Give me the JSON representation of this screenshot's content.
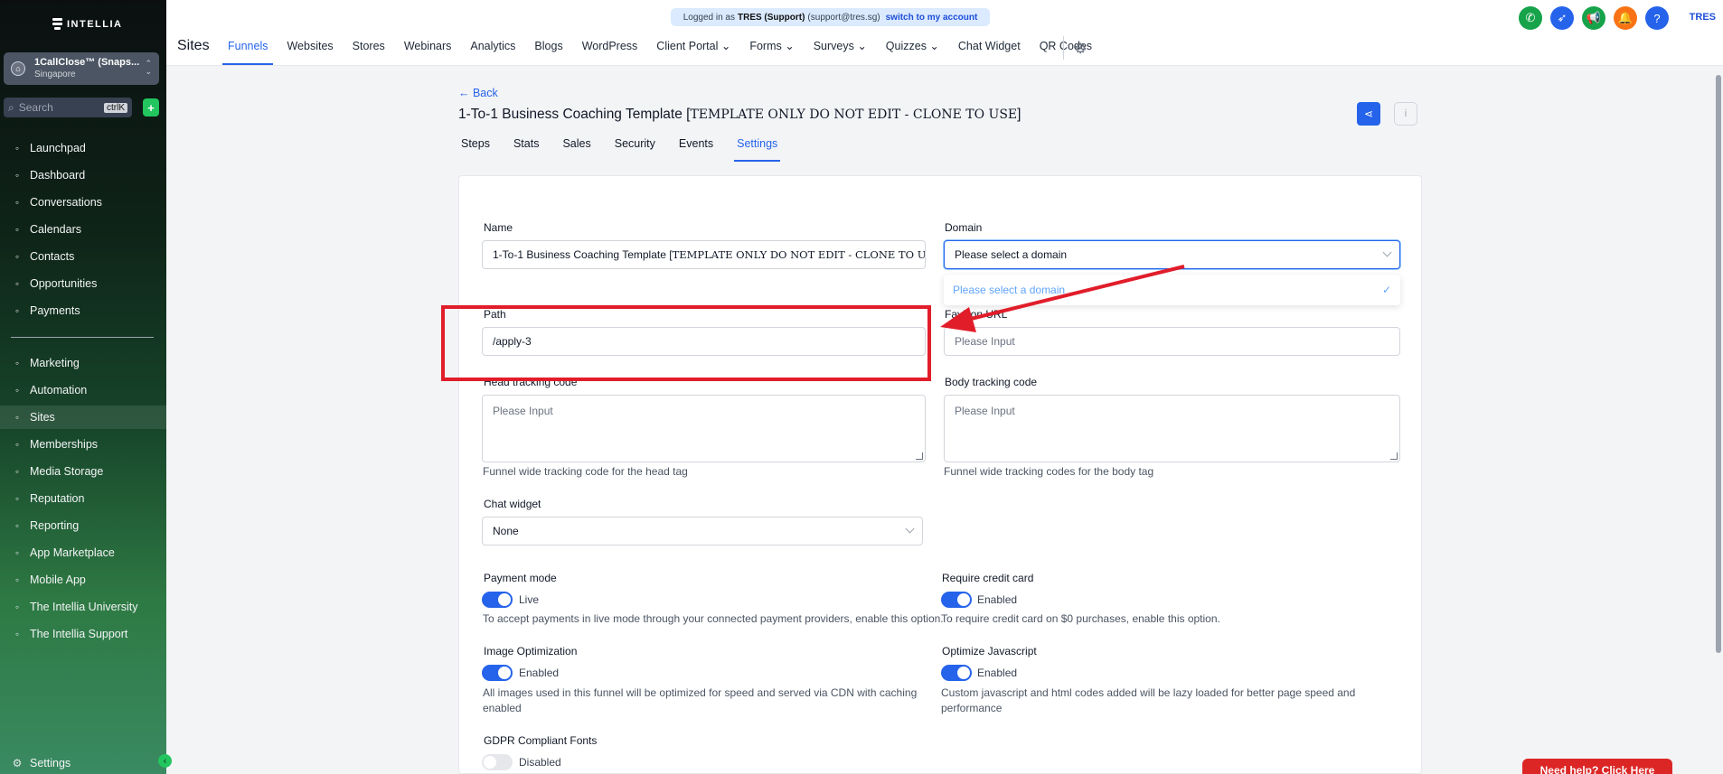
{
  "app": {
    "brand": "INTELLIA"
  },
  "account": {
    "name": "1CallClose™ (Snaps...",
    "location": "Singapore"
  },
  "search": {
    "placeholder": "Search",
    "shortcut": "ctrlK"
  },
  "sidebar": {
    "group1": [
      {
        "label": "Launchpad",
        "icon": "rocket-icon"
      },
      {
        "label": "Dashboard",
        "icon": "grid-icon"
      },
      {
        "label": "Conversations",
        "icon": "chat-icon"
      },
      {
        "label": "Calendars",
        "icon": "calendar-icon"
      },
      {
        "label": "Contacts",
        "icon": "contacts-icon"
      },
      {
        "label": "Opportunities",
        "icon": "opportunities-icon"
      },
      {
        "label": "Payments",
        "icon": "payments-icon"
      }
    ],
    "group2": [
      {
        "label": "Marketing",
        "icon": "send-icon"
      },
      {
        "label": "Automation",
        "icon": "automation-icon"
      },
      {
        "label": "Sites",
        "icon": "sites-icon"
      },
      {
        "label": "Memberships",
        "icon": "membership-icon"
      },
      {
        "label": "Media Storage",
        "icon": "image-icon"
      },
      {
        "label": "Reputation",
        "icon": "star-icon"
      },
      {
        "label": "Reporting",
        "icon": "chart-icon"
      },
      {
        "label": "App Marketplace",
        "icon": "apps-icon"
      },
      {
        "label": "Mobile App",
        "icon": "mobile-icon"
      },
      {
        "label": "The Intellia University",
        "icon": "graduation-icon"
      },
      {
        "label": "The Intellia Support",
        "icon": "headset-icon"
      }
    ],
    "settings": "Settings"
  },
  "banner": {
    "prefix": "Logged in as",
    "user": "TRES (Support)",
    "email": "(support@tres.sg)",
    "link": "switch to my account"
  },
  "top_icons": [
    {
      "name": "phone-icon",
      "color": "#16a34a",
      "glyph": "✆"
    },
    {
      "name": "rocket-icon",
      "color": "#2563eb",
      "glyph": "➶"
    },
    {
      "name": "megaphone-icon",
      "color": "#16a34a",
      "glyph": "📢"
    },
    {
      "name": "bell-icon",
      "color": "#f97316",
      "glyph": "🔔"
    },
    {
      "name": "help-icon",
      "color": "#2563eb",
      "glyph": "?"
    }
  ],
  "user_initials": "TRES",
  "header": {
    "title": "Sites",
    "tabs": [
      {
        "label": "Funnels",
        "active": true
      },
      {
        "label": "Websites"
      },
      {
        "label": "Stores"
      },
      {
        "label": "Webinars"
      },
      {
        "label": "Analytics"
      },
      {
        "label": "Blogs"
      },
      {
        "label": "WordPress"
      },
      {
        "label": "Client Portal ⌄"
      },
      {
        "label": "Forms ⌄"
      },
      {
        "label": "Surveys ⌄"
      },
      {
        "label": "Quizzes ⌄"
      },
      {
        "label": "Chat Widget"
      },
      {
        "label": "QR Codes"
      }
    ]
  },
  "page": {
    "back": "← Back",
    "title_main": "1-To-1 Business Coaching Template [",
    "title_mono": "TEMPLATE ONLY DO NOT EDIT - CLONE TO USE",
    "title_end": "]",
    "tabs": [
      "Steps",
      "Stats",
      "Sales",
      "Security",
      "Events",
      "Settings"
    ],
    "active_tab": "Settings"
  },
  "form": {
    "name": {
      "label": "Name",
      "value_main": "1-To-1 Business Coaching Template [",
      "value_mono": "TEMPLATE ONLY DO NOT EDIT - CLONE TO USE"
    },
    "domain": {
      "label": "Domain",
      "value": "Please select a domain",
      "option": "Please select a domain"
    },
    "path": {
      "label": "Path",
      "value": "/apply-3"
    },
    "favicon": {
      "label": "Favicon URL",
      "placeholder": "Please Input"
    },
    "head_code": {
      "label": "Head tracking code",
      "placeholder": "Please Input",
      "help": "Funnel wide tracking code for the head tag"
    },
    "body_code": {
      "label": "Body tracking code",
      "placeholder": "Please Input",
      "help": "Funnel wide tracking codes for the body tag"
    },
    "chat_widget": {
      "label": "Chat widget",
      "value": "None"
    },
    "payment_mode": {
      "label": "Payment mode",
      "state": "Live",
      "on": true,
      "help": "To accept payments in live mode through your connected payment providers, enable this option."
    },
    "credit_card": {
      "label": "Require credit card",
      "state": "Enabled",
      "on": true,
      "help": "To require credit card on $0 purchases, enable this option."
    },
    "image_opt": {
      "label": "Image Optimization",
      "state": "Enabled",
      "on": true,
      "help": "All images used in this funnel will be optimized for speed and served via CDN with caching enabled"
    },
    "js_opt": {
      "label": "Optimize Javascript",
      "state": "Enabled",
      "on": true,
      "help": "Custom javascript and html codes added will be lazy loaded for better page speed and performance"
    },
    "gdpr": {
      "label": "GDPR Compliant Fonts",
      "state": "Disabled",
      "on": false
    }
  },
  "help_button": "Need help? Click Here",
  "colors": {
    "accent": "#2563eb",
    "annotation": "#e11d2a"
  }
}
